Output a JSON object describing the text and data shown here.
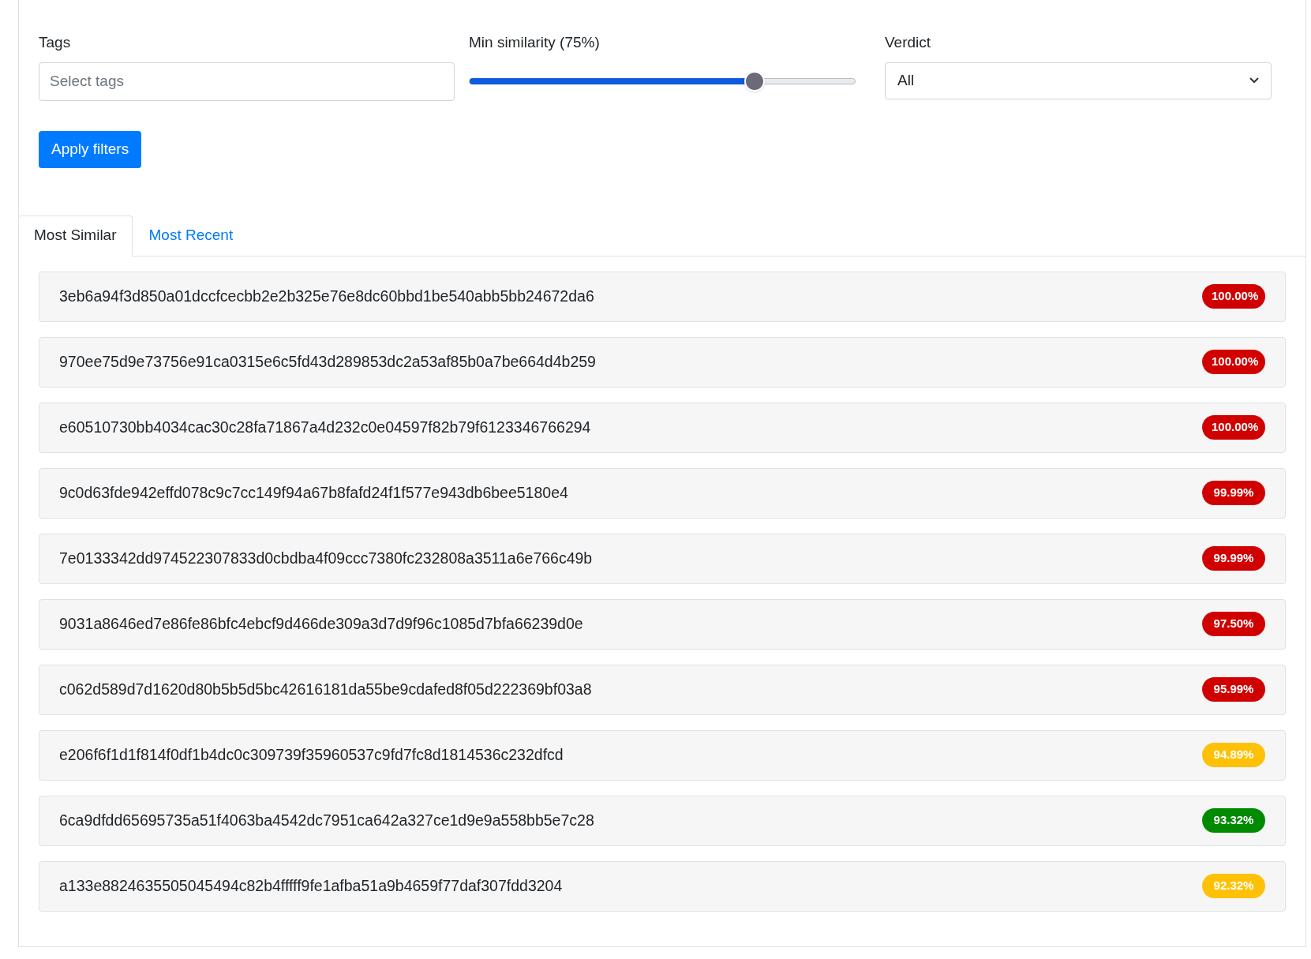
{
  "filters": {
    "tags": {
      "label": "Tags",
      "placeholder": "Select tags"
    },
    "similarity": {
      "label": "Min similarity (75%)",
      "level": 0.74
    },
    "verdict": {
      "label": "Verdict",
      "value": "All"
    },
    "apply_button": "Apply filters"
  },
  "tabs": [
    {
      "label": "Most Similar",
      "selected": true
    },
    {
      "label": "Most Recent",
      "selected": false
    }
  ],
  "results": [
    {
      "hash": "3eb6a94f3d850a01dccfcecbb2e2b325e76e8dc60bbd1be540abb5bb24672da6",
      "score": "100.00%",
      "color": "#d10000"
    },
    {
      "hash": "970ee75d9e73756e91ca0315e6c5fd43d289853dc2a53af85b0a7be664d4b259",
      "score": "100.00%",
      "color": "#d10000"
    },
    {
      "hash": "e60510730bb4034cac30c28fa71867a4d232c0e04597f82b79f6123346766294",
      "score": "100.00%",
      "color": "#d10000"
    },
    {
      "hash": "9c0d63fde942effd078c9c7cc149f94a67b8fafd24f1f577e943db6bee5180e4",
      "score": "99.99%",
      "color": "#d10000"
    },
    {
      "hash": "7e0133342dd974522307833d0cbdba4f09ccc7380fc232808a3511a6e766c49b",
      "score": "99.99%",
      "color": "#d10000"
    },
    {
      "hash": "9031a8646ed7e86fe86bfc4ebcf9d466de309a3d7d9f96c1085d7bfa66239d0e",
      "score": "97.50%",
      "color": "#d10000"
    },
    {
      "hash": "c062d589d7d1620d80b5b5d5bc42616181da55be9cdafed8f05d222369bf03a8",
      "score": "95.99%",
      "color": "#d10000"
    },
    {
      "hash": "e206f6f1d1f814f0df1b4dc0c309739f35960537c9fd7fc8d1814536c232dfcd",
      "score": "94.89%",
      "color": "#ffc107"
    },
    {
      "hash": "6ca9dfdd65695735a51f4063ba4542dc7951ca642a327ce1d9e9a558bb5e7c28",
      "score": "93.32%",
      "color": "#008a00"
    },
    {
      "hash": "a133e8824635505045494c82b4fffff9fe1afba51a9b4659f77daf307fdd3204",
      "score": "92.32%",
      "color": "#ffc107"
    }
  ]
}
